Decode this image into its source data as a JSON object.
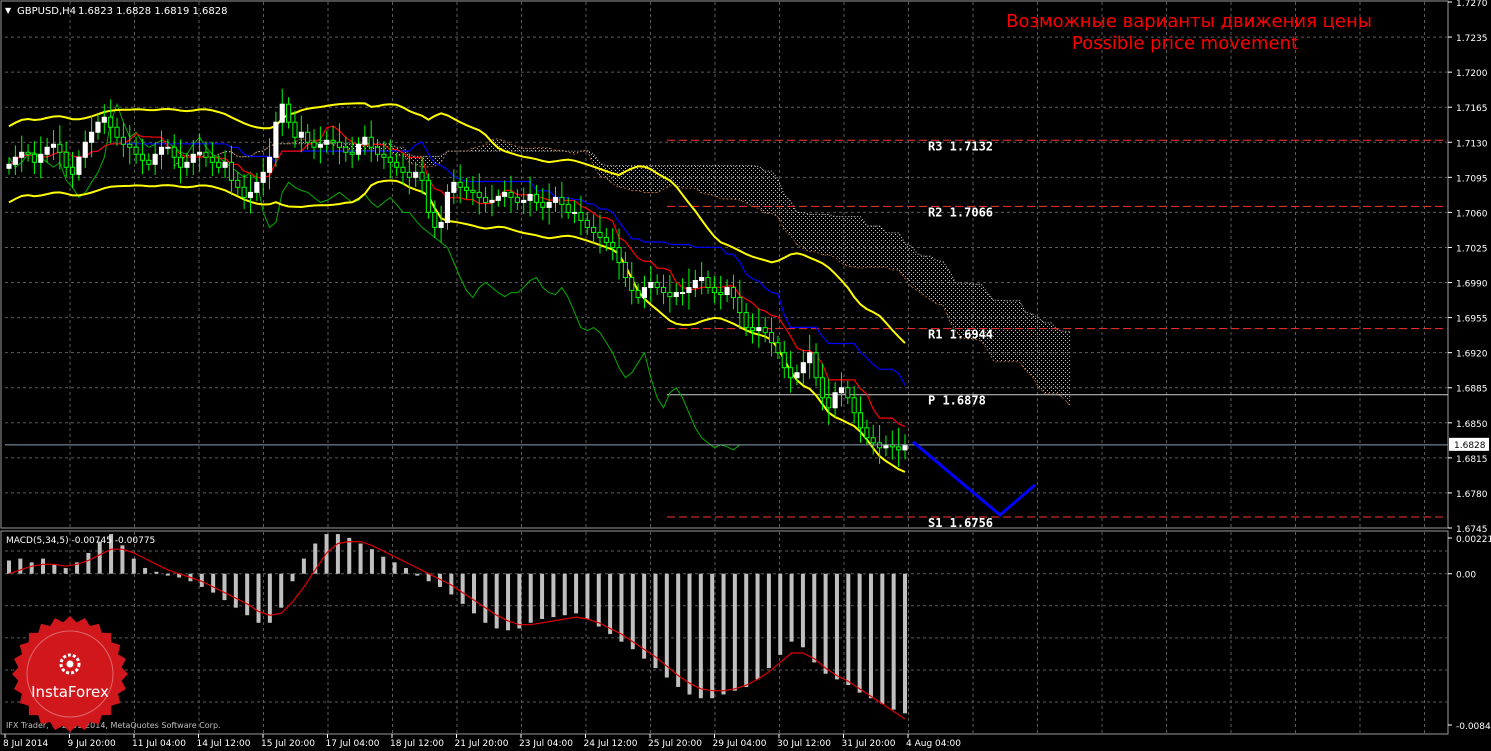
{
  "header": {
    "symbol": "GBPUSD,H4",
    "ohlc": "1.6823 1.6828 1.6819 1.6828",
    "arrow": "▼"
  },
  "title": {
    "ru": "Возможные варианты движения цены",
    "en": "Possible price movement"
  },
  "macd": {
    "label": "MACD(5,34,5) -0.00745 -0.00775"
  },
  "copyright": "IFX Trader, © 2001-2014, MetaQuotes Software Corp.",
  "logo": {
    "name": "InstaForex"
  },
  "colors": {
    "background": "#000000",
    "grid": "#5c5c5c",
    "candle_up": "#ffffff",
    "candle_down": "#00ff00",
    "bollinger": "#ffff00",
    "tenkan": "#ff0000",
    "kijun": "#0000ff",
    "chikou": "#00b000",
    "cloud": "#c0c0c0",
    "pivot": "#ff3030",
    "forecast": "#0000ff",
    "macd_hist": "#c0c0c0",
    "macd_signal": "#e00000",
    "title": "#ff0000",
    "logo": "#d0181c"
  },
  "chart_data": [
    {
      "type": "candlestick",
      "instrument": "GBPUSD",
      "timeframe": "H4",
      "ylim": [
        1.675,
        1.727
      ],
      "y_ticks": [
        "1.7270",
        "1.7235",
        "1.7200",
        "1.7165",
        "1.7130",
        "1.7095",
        "1.7060",
        "1.7025",
        "1.6990",
        "1.6955",
        "1.6920",
        "1.6885",
        "1.6850",
        "1.6815",
        "1.6780",
        "1.6745"
      ],
      "current_price": "1.6828",
      "x_ticks": [
        "8 Jul 2014",
        "9 Jul 20:00",
        "11 Jul 04:00",
        "14 Jul 12:00",
        "15 Jul 20:00",
        "17 Jul 04:00",
        "18 Jul 12:00",
        "21 Jul 20:00",
        "23 Jul 04:00",
        "24 Jul 12:00",
        "25 Jul 20:00",
        "29 Jul 04:00",
        "30 Jul 12:00",
        "31 Jul 20:00",
        "4 Aug 04:00"
      ],
      "pivot_levels": [
        {
          "name": "R3",
          "value": 1.7132,
          "label": "R3  1.7132"
        },
        {
          "name": "R2",
          "value": 1.7066,
          "label": "R2  1.7066"
        },
        {
          "name": "R1",
          "value": 1.6944,
          "label": "R1  1.6944"
        },
        {
          "name": "P",
          "value": 1.6878,
          "label": "P  1.6878"
        },
        {
          "name": "S1",
          "value": 1.6756,
          "label": "S1  1.6756"
        }
      ],
      "close": [
        1.7108,
        1.7115,
        1.712,
        1.7118,
        1.711,
        1.7118,
        1.7125,
        1.7128,
        1.712,
        1.7105,
        1.7098,
        1.7115,
        1.713,
        1.714,
        1.715,
        1.7155,
        1.7145,
        1.7135,
        1.7128,
        1.7125,
        1.7118,
        1.7112,
        1.7108,
        1.7118,
        1.7125,
        1.7125,
        1.7115,
        1.7105,
        1.711,
        1.7118,
        1.712,
        1.7115,
        1.711,
        1.7105,
        1.711,
        1.7092,
        1.7085,
        1.7075,
        1.708,
        1.709,
        1.71,
        1.7115,
        1.715,
        1.7168,
        1.715,
        1.7135,
        1.714,
        1.713,
        1.7125,
        1.7128,
        1.7132,
        1.713,
        1.7125,
        1.712,
        1.7118,
        1.7128,
        1.7135,
        1.7125,
        1.7118,
        1.7115,
        1.711,
        1.7105,
        1.71,
        1.7095,
        1.71,
        1.7092,
        1.706,
        1.7045,
        1.705,
        1.708,
        1.709,
        1.7085,
        1.7082,
        1.708,
        1.7075,
        1.707,
        1.7072,
        1.7076,
        1.708,
        1.7075,
        1.707,
        1.7072,
        1.7078,
        1.707,
        1.7065,
        1.707,
        1.7075,
        1.7068,
        1.706,
        1.706,
        1.7052,
        1.7045,
        1.704,
        1.7035,
        1.703,
        1.7025,
        1.701,
        1.6995,
        1.6982,
        1.6975,
        1.6985,
        1.699,
        1.6985,
        1.698,
        1.6976,
        1.698,
        1.698,
        1.6985,
        1.6992,
        1.6995,
        1.6985,
        1.698,
        1.6978,
        1.6985,
        1.6975,
        1.696,
        1.6945,
        1.6942,
        1.6945,
        1.694,
        1.693,
        1.692,
        1.6905,
        1.6895,
        1.69,
        1.691,
        1.692,
        1.6895,
        1.6875,
        1.6865,
        1.688,
        1.6885,
        1.6875,
        1.686,
        1.6845,
        1.6835,
        1.683,
        1.6825,
        1.6828,
        1.6826,
        1.6823,
        1.6828
      ]
    },
    {
      "type": "bar",
      "indicator": "MACD(5,34,5)",
      "macd": -0.00745,
      "signal": -0.00775,
      "ylim": [
        -0.00844,
        0.00221
      ],
      "y_ticks": [
        "0.00221",
        "0.00",
        "-0.00844"
      ],
      "histogram": [
        0.0007,
        0.0008,
        0.0006,
        0.0008,
        0.0005,
        0.0003,
        0.0006,
        0.0011,
        0.0017,
        0.0021,
        0.0015,
        0.0008,
        0.0003,
        0.0001,
        -0.0001,
        -0.0002,
        -0.0004,
        -0.0007,
        -0.001,
        -0.0014,
        -0.0018,
        -0.0022,
        -0.0026,
        -0.0026,
        -0.0018,
        -0.0004,
        0.0008,
        0.0016,
        0.0021,
        0.0021,
        0.0019,
        0.0016,
        0.0013,
        0.0009,
        0.0006,
        0.0003,
        -0.0001,
        -0.0004,
        -0.0007,
        -0.0011,
        -0.0016,
        -0.0021,
        -0.0026,
        -0.0029,
        -0.003,
        -0.0029,
        -0.0026,
        -0.0024,
        -0.0023,
        -0.0022,
        -0.0021,
        -0.0024,
        -0.0028,
        -0.0032,
        -0.0036,
        -0.004,
        -0.0045,
        -0.005,
        -0.0055,
        -0.006,
        -0.0064,
        -0.0066,
        -0.0066,
        -0.0064,
        -0.0062,
        -0.006,
        -0.0056,
        -0.005,
        -0.0043,
        -0.0036,
        -0.0039,
        -0.0047,
        -0.0053,
        -0.0056,
        -0.0059,
        -0.0063,
        -0.0066,
        -0.0069,
        -0.0072,
        -0.0074
      ],
      "signal_line": [
        0.0,
        0.0002,
        0.0004,
        0.0005,
        0.0005,
        0.0004,
        0.0005,
        0.0007,
        0.001,
        0.0013,
        0.0013,
        0.0011,
        0.0008,
        0.0005,
        0.0002,
        0.0,
        -0.0002,
        -0.0004,
        -0.0007,
        -0.001,
        -0.0013,
        -0.0016,
        -0.002,
        -0.0022,
        -0.0021,
        -0.0015,
        -0.0007,
        0.0002,
        0.0011,
        0.0016,
        0.0017,
        0.0017,
        0.0015,
        0.0012,
        0.0009,
        0.0006,
        0.0003,
        0.0,
        -0.0003,
        -0.0006,
        -0.001,
        -0.0014,
        -0.0018,
        -0.0022,
        -0.0025,
        -0.0027,
        -0.0027,
        -0.0026,
        -0.0025,
        -0.0024,
        -0.0023,
        -0.0024,
        -0.0026,
        -0.0029,
        -0.0032,
        -0.0036,
        -0.004,
        -0.0044,
        -0.0049,
        -0.0054,
        -0.0058,
        -0.0061,
        -0.0062,
        -0.0062,
        -0.0061,
        -0.0059,
        -0.0056,
        -0.0052,
        -0.0047,
        -0.0042,
        -0.0042,
        -0.0045,
        -0.005,
        -0.0054,
        -0.0057,
        -0.0061,
        -0.0065,
        -0.0069,
        -0.0073,
        -0.0077
      ]
    }
  ]
}
